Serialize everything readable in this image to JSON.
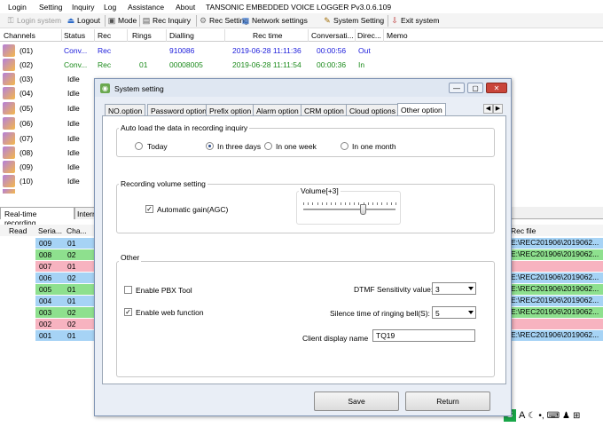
{
  "menu": {
    "items": [
      "Login",
      "Setting",
      "Inquiry",
      "Log",
      "Assistance",
      "About"
    ],
    "app_title": "TANSONIC EMBEDDED VOICE LOGGER Pv3.0.6.109"
  },
  "toolbar": {
    "login_system": "Login system",
    "logout": "Logout",
    "mode": "Mode",
    "rec_inquiry": "Rec Inquiry",
    "rec_setting": "Rec Setting",
    "network_settings": "Network settings",
    "system_setting": "System Setting",
    "exit_system": "Exit system"
  },
  "channels": {
    "headers": {
      "channels": "Channels",
      "status": "Status",
      "rec": "Rec",
      "rings": "Rings",
      "dialling": "Dialling",
      "rec_time": "Rec time",
      "conversation": "Conversati...",
      "direction": "Direc...",
      "memo": "Memo"
    },
    "rows": [
      {
        "ch": "(01)",
        "status": "Conv...",
        "rec": "Rec",
        "rings": "",
        "dialling": "910086",
        "rec_time": "2019-06-28 11:11:36",
        "conv": "00:00:56",
        "dir": "Out",
        "color": "#1a1adb"
      },
      {
        "ch": "(02)",
        "status": "Conv...",
        "rec": "Rec",
        "rings": "01",
        "dialling": "00008005",
        "rec_time": "2019-06-28 11:11:54",
        "conv": "00:00:36",
        "dir": "In",
        "color": "#1a8a1a"
      },
      {
        "ch": "(03)",
        "status": "Idle"
      },
      {
        "ch": "(04)",
        "status": "Idle"
      },
      {
        "ch": "(05)",
        "status": "Idle"
      },
      {
        "ch": "(06)",
        "status": "Idle"
      },
      {
        "ch": "(07)",
        "status": "Idle"
      },
      {
        "ch": "(08)",
        "status": "Idle"
      },
      {
        "ch": "(09)",
        "status": "Idle"
      },
      {
        "ch": "(10)",
        "status": "Idle"
      }
    ]
  },
  "bottom_tabs": {
    "realtime": "Real-time recording",
    "internal": "Intern"
  },
  "realtime": {
    "headers": {
      "read": "Read",
      "serial": "Seria...",
      "channel": "Cha...",
      "rec_file": "Rec file"
    },
    "rows": [
      {
        "serial": "009",
        "ch": "01",
        "color": "#a6d3f5",
        "file": "E:\\REC201906\\2019062..."
      },
      {
        "serial": "008",
        "ch": "02",
        "color": "#8ee08e",
        "file": "E:\\REC201906\\2019062..."
      },
      {
        "serial": "007",
        "ch": "01",
        "color": "#f7b3c0",
        "file": ""
      },
      {
        "serial": "006",
        "ch": "02",
        "color": "#a6d3f5",
        "file": "E:\\REC201906\\2019062..."
      },
      {
        "serial": "005",
        "ch": "01",
        "color": "#8ee08e",
        "file": "E:\\REC201906\\2019062..."
      },
      {
        "serial": "004",
        "ch": "01",
        "color": "#a6d3f5",
        "file": "E:\\REC201906\\2019062..."
      },
      {
        "serial": "003",
        "ch": "02",
        "color": "#8ee08e",
        "file": "E:\\REC201906\\2019062..."
      },
      {
        "serial": "002",
        "ch": "02",
        "color": "#f7b3c0",
        "file": ""
      },
      {
        "serial": "001",
        "ch": "01",
        "color": "#a6d3f5",
        "file": "E:\\REC201906\\2019062..."
      }
    ]
  },
  "dialog": {
    "title": "System setting",
    "tabs": [
      "NO.option",
      "Password option",
      "Prefix option",
      "Alarm option",
      "CRM option",
      "Cloud options",
      "Other option"
    ],
    "autoload": {
      "legend": "Auto load the data in recording inquiry",
      "options": [
        "Today",
        "In three days",
        "In one week",
        "In one month"
      ],
      "selected": 1
    },
    "volume": {
      "legend": "Recording volume setting",
      "agc_label": "Automatic gain(AGC)",
      "agc_checked": true,
      "slider_label": "Volume[+3]",
      "slider_value": 3,
      "slider_min": -10,
      "slider_max": 10
    },
    "other": {
      "legend": "Other",
      "pbx_label": "Enable PBX Tool",
      "pbx_checked": false,
      "web_label": "Enable web function",
      "web_checked": true,
      "dtmf_label": "DTMF Sensitivity value:",
      "dtmf_value": "3",
      "silence_label": "Silence time of ringing bell(S):",
      "silence_value": "5",
      "client_label": "Client display name",
      "client_value": "TQ19"
    },
    "save": "Save",
    "return": "Return"
  },
  "ime": {
    "s_label": "S",
    "a_label": "A"
  }
}
